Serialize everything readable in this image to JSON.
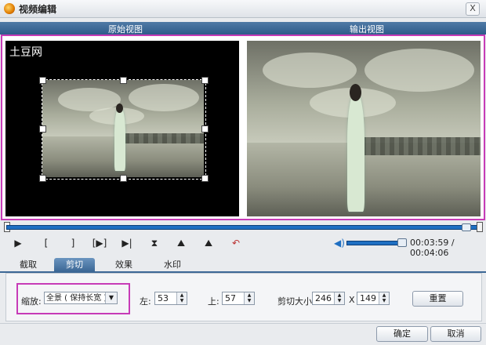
{
  "window": {
    "title": "视频编辑",
    "close_glyph": "X"
  },
  "header": {
    "left": "原始视图",
    "right": "输出视图"
  },
  "preview": {
    "watermark": "土豆网"
  },
  "playback": {
    "controls": [
      "▶",
      "[",
      "]",
      "[▶]",
      "▶|",
      "⧗",
      "⛰",
      "⛰",
      "↶"
    ],
    "time": "00:03:59 / 00:04:06",
    "position_fraction": 0.972,
    "volume_fraction": 0.9
  },
  "tabs": [
    {
      "label": "截取",
      "active": false
    },
    {
      "label": "剪切",
      "active": true
    },
    {
      "label": "效果",
      "active": false
    },
    {
      "label": "水印",
      "active": false
    }
  ],
  "crop": {
    "zoom_label": "缩放:",
    "zoom_value": "全景 ( 保持长宽 )",
    "left_label": "左:",
    "left_value": "53",
    "top_label": "上:",
    "top_value": "57",
    "size_label": "剪切大小:",
    "width_value": "246",
    "x_label": "X",
    "height_value": "149",
    "reset_label": "重置"
  },
  "footer": {
    "ok_label": "确定",
    "cancel_label": "取消"
  }
}
